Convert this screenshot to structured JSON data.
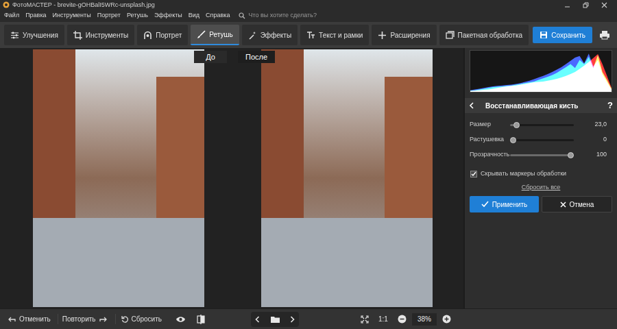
{
  "window": {
    "title": "ФотоМАСТЕР - brevite-gOHBalI5WRc-unsplash.jpg"
  },
  "menu": [
    "Файл",
    "Правка",
    "Инструменты",
    "Портрет",
    "Ретушь",
    "Эффекты",
    "Вид",
    "Справка"
  ],
  "search": {
    "placeholder": "Что вы хотите сделать?"
  },
  "tabs": [
    {
      "label": "Улучшения",
      "selected": false
    },
    {
      "label": "Инструменты",
      "selected": false
    },
    {
      "label": "Портрет",
      "selected": false
    },
    {
      "label": "Ретушь",
      "selected": true
    },
    {
      "label": "Эффекты",
      "selected": false
    },
    {
      "label": "Текст и рамки",
      "selected": false
    },
    {
      "label": "Расширения",
      "selected": false
    }
  ],
  "batch_button": "Пакетная обработка",
  "save_button": "Сохранить",
  "preview": {
    "before_label": "До",
    "after_label": "После"
  },
  "histogram": {
    "series": [
      {
        "color": "#ff2b2b",
        "values": [
          2,
          3,
          4,
          5,
          6,
          8,
          10,
          12,
          14,
          15,
          16,
          18,
          20,
          22,
          24,
          25,
          26,
          28,
          30,
          33,
          36,
          40,
          45,
          50,
          58,
          66,
          75,
          85,
          95,
          70,
          40,
          10
        ]
      },
      {
        "color": "#2bff4a",
        "values": [
          3,
          4,
          6,
          8,
          10,
          12,
          13,
          14,
          15,
          16,
          18,
          20,
          22,
          24,
          26,
          30,
          34,
          38,
          42,
          48,
          55,
          62,
          70,
          60,
          80,
          70,
          88,
          60,
          92,
          50,
          30,
          8
        ]
      },
      {
        "color": "#3a5bff",
        "values": [
          4,
          6,
          8,
          10,
          12,
          14,
          15,
          16,
          17,
          18,
          20,
          22,
          25,
          28,
          32,
          36,
          40,
          45,
          50,
          56,
          62,
          70,
          78,
          86,
          90,
          72,
          96,
          64,
          80,
          45,
          25,
          6
        ]
      }
    ]
  },
  "tool_panel": {
    "title": "Восстанавливающая кисть",
    "help": "?",
    "sliders": [
      {
        "label": "Размер",
        "value": "23,0",
        "level": 0.06
      },
      {
        "label": "Растушевка",
        "value": "0",
        "level": 0
      },
      {
        "label": "Прозрачность",
        "value": "100",
        "level": 1
      }
    ],
    "hide_markers": {
      "label": "Скрывать маркеры обработки",
      "checked": true
    },
    "reset_all": "Сбросить все",
    "apply": "Применить",
    "cancel": "Отмена"
  },
  "bottom_bar": {
    "undo": "Отменить",
    "redo": "Повторить",
    "reset": "Сбросить",
    "zoom_actual": "1:1",
    "zoom": "38%"
  }
}
